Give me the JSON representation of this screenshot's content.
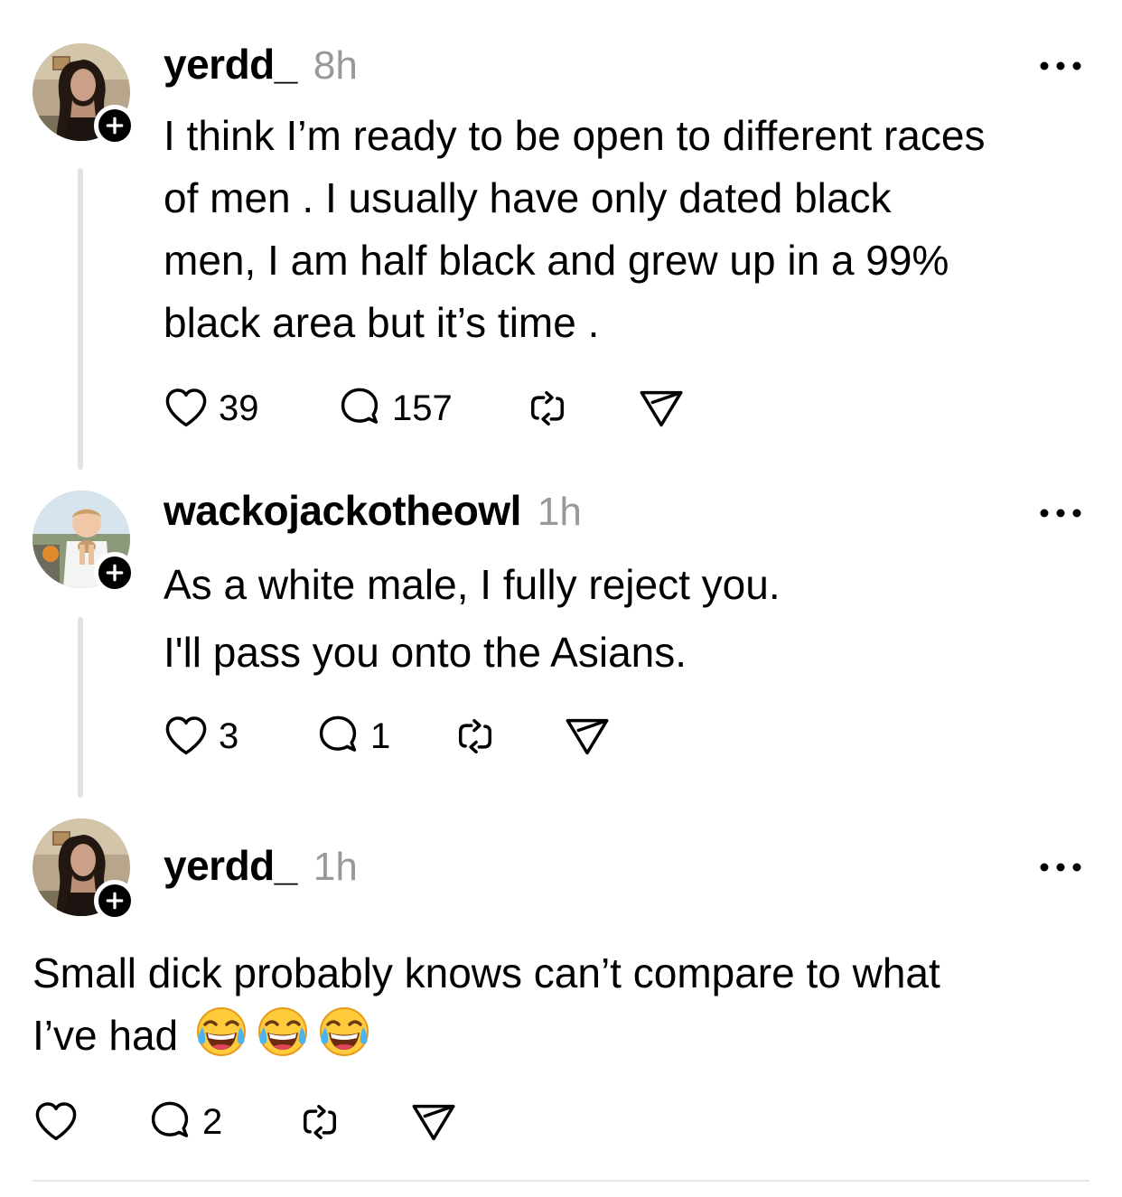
{
  "posts": [
    {
      "username": "yerdd_",
      "time": "8h",
      "lines": [
        "I think I’m ready to be open to different races",
        "of men .  I usually have only dated black",
        "men, I  am half black and grew up in a 99%",
        "black area but it’s time ."
      ],
      "likes": "39",
      "replies": "157"
    },
    {
      "username": "wackojackotheowl",
      "time": "1h",
      "lines": [
        "As a white male, I fully reject you.",
        "I'll pass you onto the Asians."
      ],
      "likes": "3",
      "replies": "1"
    },
    {
      "username": "yerdd_",
      "time": "1h",
      "lines": [
        "Small dick probably knows can’t compare to what",
        "I’ve had"
      ],
      "likes": "",
      "replies": "2"
    }
  ],
  "icons": {
    "like": "heart-icon",
    "reply": "comment-bubble-icon",
    "repost": "repost-icon",
    "share": "send-icon",
    "more": "ellipsis-icon",
    "follow": "plus-icon",
    "emoji": "face-with-tears-of-joy-emoji"
  }
}
